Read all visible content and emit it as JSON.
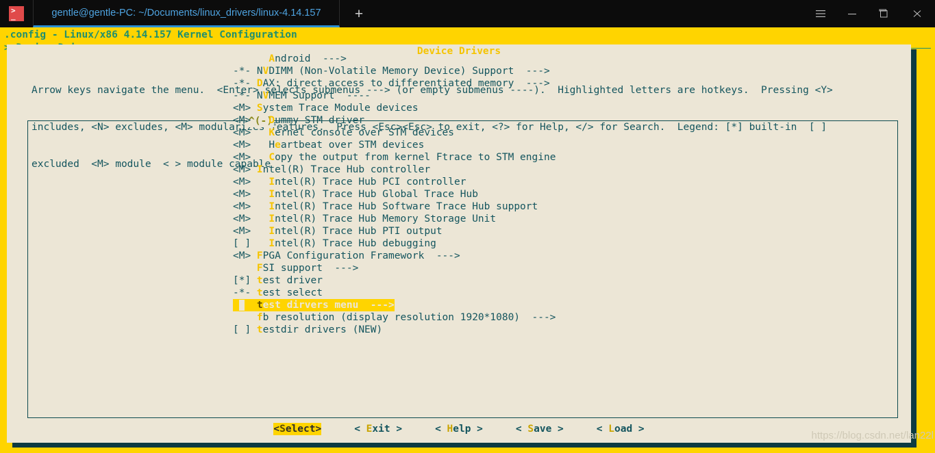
{
  "window": {
    "tab_title": "gentle@gentle-PC: ~/Documents/linux_drivers/linux-4.14.157",
    "new_tab_label": "+",
    "icon_glyph_top": ">",
    "icon_glyph_bottom": "_",
    "colors": {
      "titlebar_bg": "#0c0c0c",
      "tab_text": "#4ea3e0",
      "tab_underline": "#2b8fd4",
      "terminal_bg": "#ffd400",
      "dialog_bg": "#ece6d6",
      "dialog_shadow": "#0d3b42",
      "body_text": "#14555e",
      "hotkey": "#f5c400",
      "header_text": "#1f8f6e",
      "selection_bg": "#ffd400"
    }
  },
  "kconfig": {
    "title": ".config - Linux/x86 4.14.157 Kernel Configuration",
    "breadcrumb": "> Device Drivers",
    "dialog_title": "Device Drivers",
    "help_lines": [
      "Arrow keys navigate the menu.  <Enter> selects submenus ---> (or empty submenus ----).  Highlighted letters are hotkeys.  Pressing <Y>",
      "includes, <N> excludes, <M> modularizes features.  Press <Esc><Esc> to exit, <?> for Help, </> for Search.  Legend: [*] built-in  [ ]",
      "excluded  <M> module  < > module capable"
    ],
    "scroll_indicator": "^(-)",
    "items": [
      {
        "state": "    ",
        "indent": "  ",
        "hotkey": "A",
        "rest": "ndroid  --->",
        "selected": false
      },
      {
        "state": "-*- ",
        "indent": "",
        "hotkey": "NV",
        "hotkey_pre": "N",
        "rest": "DIMM (Non-Volatile Memory Device) Support  --->",
        "selected": false
      },
      {
        "state": "-*- ",
        "indent": "",
        "hotkey": "D",
        "rest": "AX: direct access to differentiated memory  --->",
        "selected": false
      },
      {
        "state": "-*- ",
        "indent": "",
        "hotkey": "NV",
        "rest": "MEM Support  ----",
        "selected": false
      },
      {
        "state": "<M> ",
        "indent": "",
        "hotkey": "S",
        "rest": "ystem Trace Module devices",
        "selected": false
      },
      {
        "state": "<M> ",
        "indent": "  ",
        "hotkey": "D",
        "rest": "ummy STM driver",
        "selected": false
      },
      {
        "state": "<M> ",
        "indent": "  ",
        "hotkey": "K",
        "rest": "ernel console over STM devices",
        "selected": false
      },
      {
        "state": "<M> ",
        "indent": "  ",
        "hotkey": "H",
        "hotkey2": "e",
        "rest": "artbeat over STM devices",
        "selected": false
      },
      {
        "state": "<M> ",
        "indent": "  ",
        "hotkey": "C",
        "rest": "opy the output from kernel Ftrace to STM engine",
        "selected": false
      },
      {
        "state": "<M> ",
        "indent": "",
        "hotkey": "I",
        "rest": "ntel(R) Trace Hub controller",
        "selected": false
      },
      {
        "state": "<M> ",
        "indent": "  ",
        "hotkey": "I",
        "rest": "ntel(R) Trace Hub PCI controller",
        "selected": false
      },
      {
        "state": "<M> ",
        "indent": "  ",
        "hotkey": "I",
        "rest": "ntel(R) Trace Hub Global Trace Hub",
        "selected": false
      },
      {
        "state": "<M> ",
        "indent": "  ",
        "hotkey": "I",
        "rest": "ntel(R) Trace Hub Software Trace Hub support",
        "selected": false
      },
      {
        "state": "<M> ",
        "indent": "  ",
        "hotkey": "I",
        "rest": "ntel(R) Trace Hub Memory Storage Unit",
        "selected": false
      },
      {
        "state": "<M> ",
        "indent": "  ",
        "hotkey": "I",
        "rest": "ntel(R) Trace Hub PTI output",
        "selected": false
      },
      {
        "state": "[ ] ",
        "indent": "  ",
        "hotkey": "I",
        "rest": "ntel(R) Trace Hub debugging",
        "selected": false
      },
      {
        "state": "<M> ",
        "indent": "",
        "hotkey": "F",
        "rest": "PGA Configuration Framework  --->",
        "selected": false
      },
      {
        "state": "    ",
        "indent": "",
        "hotkey": "F",
        "rest": "SI support  --->",
        "selected": false
      },
      {
        "state": "[*] ",
        "indent": "",
        "hotkey": "t",
        "rest": "est driver",
        "selected": false
      },
      {
        "state": "-*- ",
        "indent": "",
        "hotkey": "t",
        "rest": "est select",
        "selected": false
      },
      {
        "state": "    ",
        "indent": "",
        "hotkey": "t",
        "rest": "est dirvers menu  --->",
        "selected": true
      },
      {
        "state": "    ",
        "indent": "",
        "hotkey": "f",
        "rest": "b resolution (display resolution 1920*1080)  --->",
        "selected": false
      },
      {
        "state": "[ ] ",
        "indent": "",
        "hotkey": "t",
        "rest": "estdir drivers (NEW)",
        "selected": false
      }
    ],
    "buttons": [
      {
        "pre": "<",
        "hotkey": "S",
        "post": "elect>",
        "active": true
      },
      {
        "pre": "< ",
        "hotkey": "E",
        "post": "xit >",
        "active": false
      },
      {
        "pre": "< ",
        "hotkey": "H",
        "post": "elp >",
        "active": false
      },
      {
        "pre": "< ",
        "hotkey": "S",
        "post": "ave >",
        "active": false
      },
      {
        "pre": "< ",
        "hotkey": "L",
        "post": "oad >",
        "active": false
      }
    ]
  },
  "watermark": {
    "text": "https://blog.csdn.net/lan22l"
  }
}
